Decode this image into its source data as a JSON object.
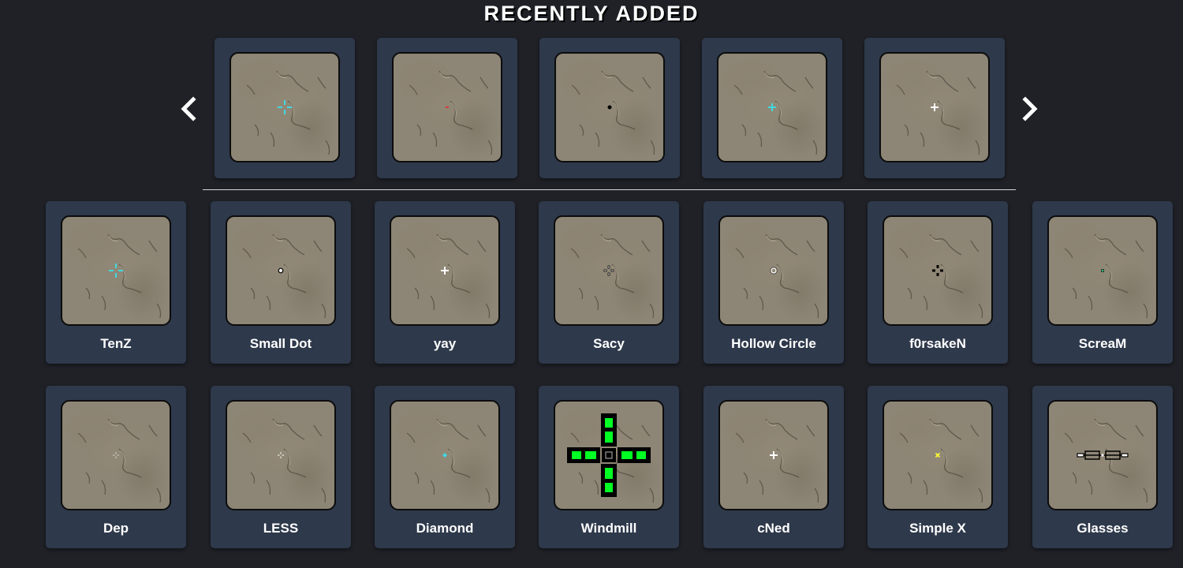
{
  "section": {
    "title": "RECENTLY ADDED"
  },
  "carousel": {
    "prev_icon": "chevron-left-icon",
    "next_icon": "chevron-right-icon",
    "items": [
      {
        "crosshair": "cyan-gap-cross",
        "color": "#3fd9e0"
      },
      {
        "crosshair": "red-dot",
        "color": "#d23a3a"
      },
      {
        "crosshair": "black-dot",
        "color": "#000000"
      },
      {
        "crosshair": "cyan-plus",
        "color": "#3fd9e0"
      },
      {
        "crosshair": "white-plus",
        "color": "#ffffff"
      }
    ]
  },
  "grid": {
    "items": [
      {
        "label": "TenZ",
        "crosshair": "cyan-gap-cross",
        "color": "#3fd9e0"
      },
      {
        "label": "Small Dot",
        "crosshair": "outlined-dot",
        "color": "#ffffff"
      },
      {
        "label": "yay",
        "crosshair": "white-plus",
        "color": "#ffffff"
      },
      {
        "label": "Sacy",
        "crosshair": "outlined-gap-cross",
        "color": "#ffffff"
      },
      {
        "label": "Hollow Circle",
        "crosshair": "hollow-circle",
        "color": "#ffffff"
      },
      {
        "label": "f0rsakeN",
        "crosshair": "black-gap-cross",
        "color": "#000000"
      },
      {
        "label": "ScreaM",
        "crosshair": "green-dot",
        "color": "#2ec27e"
      },
      {
        "label": "Dep",
        "crosshair": "tiny-gap-cross",
        "color": "#d0d0d0"
      },
      {
        "label": "LESS",
        "crosshair": "tiny-white-cross",
        "color": "#ffffff"
      },
      {
        "label": "Diamond",
        "crosshair": "cyan-diamond",
        "color": "#3fd9e0"
      },
      {
        "label": "Windmill",
        "crosshair": "green-windmill",
        "color": "#00ff22"
      },
      {
        "label": "cNed",
        "crosshair": "white-plus",
        "color": "#ffffff"
      },
      {
        "label": "Simple X",
        "crosshair": "yellow-x",
        "color": "#ffff33"
      },
      {
        "label": "Glasses",
        "crosshair": "glasses",
        "color": "#000000"
      }
    ]
  }
}
